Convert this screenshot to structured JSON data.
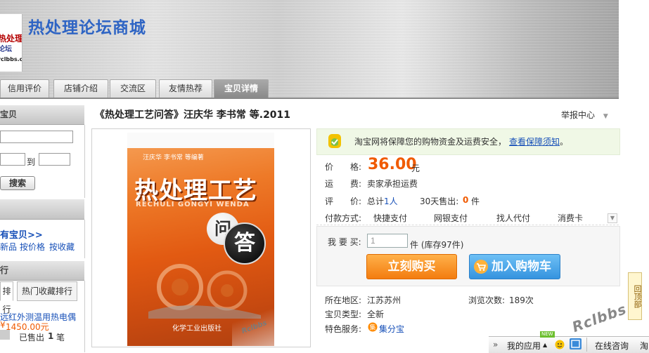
{
  "header": {
    "shop_title": "热处理论坛商城",
    "logo": {
      "line1": "热处理",
      "line2": "论坛",
      "line3": "rclbbs.com"
    }
  },
  "tabs": [
    {
      "label": "信用评价",
      "active": false
    },
    {
      "label": "店铺介绍",
      "active": false
    },
    {
      "label": "交流区",
      "active": false
    },
    {
      "label": "友情热荐",
      "active": false
    },
    {
      "label": "宝贝详情",
      "active": true
    }
  ],
  "sidebar": {
    "search_head": "宝贝",
    "price_to": "到",
    "search_button": "搜索",
    "all_items_link": "有宝贝>>",
    "sort_links": [
      "新品",
      "按价格",
      "按收藏"
    ],
    "rank_head": "行",
    "rank_tabs": [
      "排行",
      "热门收藏排行"
    ],
    "rank_item": {
      "name": "远红外测温用热电偶",
      "price": "1450.00元",
      "sold_prefix": "已售出",
      "sold_count": "1",
      "sold_unit": "笔"
    }
  },
  "product": {
    "title": "《热处理工艺问答》汪庆华 李书常 等.2011",
    "report_label": "举报中心",
    "image": {
      "authors": "汪庆华   李书常     等编著",
      "title": "热处理工艺",
      "pinyin": "RECHULI GONGYI WENDA",
      "bubble1": "问",
      "bubble2": "答",
      "publisher": "化学工业出版社",
      "watermark": "Rclbbs"
    }
  },
  "assurance": {
    "text": "淘宝网将保障您的购物资金及运费安全，",
    "link": "查看保障须知",
    "suffix": "。"
  },
  "details": {
    "price_label": "价　　格:",
    "price_value": "36.00",
    "price_unit": "元",
    "shipping_label": "运　　费:",
    "shipping_value": "卖家承担运费",
    "rating_label": "评　　价:",
    "rating_total_prefix": "总计",
    "rating_total": "1人",
    "sold_30_label": "30天售出:",
    "sold_30_value": "0",
    "sold_30_unit": "件",
    "pay_label": "付款方式:",
    "pay_methods": [
      "快捷支付",
      "网银支付",
      "找人代付",
      "消费卡"
    ]
  },
  "buy": {
    "qty_label": "我 要 买:",
    "qty_value": "1",
    "stock_text": "件 (库存97件)",
    "buy_now": "立刻购买",
    "add_cart": "加入购物车"
  },
  "meta": {
    "location_label": "所在地区:",
    "location_value": "江苏苏州",
    "views_label": "浏览次数:",
    "views_value": "189次",
    "type_label": "宝贝类型:",
    "type_value": "全新",
    "service_label": "特色服务:",
    "service_value": "集分宝"
  },
  "widgets": {
    "to_top": "回顶部",
    "rclbbs": "Rclbbs",
    "taskbar_arrow": "»",
    "taskbar_apps": "我的应用",
    "taskbar_new": "NEW",
    "taskbar_chat": "在线咨询",
    "taskbar_more": "淘"
  },
  "colors": {
    "shop_title": "#2e64c4",
    "price": "#f05a00",
    "buy_now": "#f37c0f",
    "add_cart": "#3593df",
    "link": "#1750b8"
  }
}
